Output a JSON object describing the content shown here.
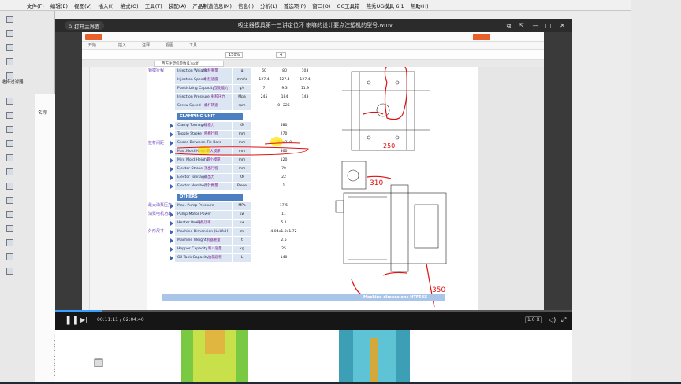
{
  "cad": {
    "menus": [
      "文件(F)",
      "编辑(E)",
      "视图(V)",
      "插入(I)",
      "格式(O)",
      "工具(T)",
      "装配(A)",
      "产品制造信息(M)",
      "信息(I)",
      "分析(L)",
      "首选项(P)",
      "窗口(O)",
      "GC工具箱",
      "燕秀UG模具 6.1",
      "帮助(H)"
    ],
    "tree_panel_title": "选择过滤器",
    "tree_name_header": "名称"
  },
  "player": {
    "open_home_label": "打开主界面",
    "title": "吸尘器模具第十三讲定位环 喇嘛的设计要点注塑机的型号.wmv",
    "time": "00:11:11 / 02:04:40",
    "speed": "1.0 X",
    "progress": 0.09
  },
  "pdf": {
    "tab_title": "西方注塑机参数(1).pdf",
    "zoom": "150%",
    "page_num": "4",
    "menu_items": [
      "开始",
      "插入",
      "注释",
      "视图",
      "工具"
    ],
    "rows": [
      {
        "label": "Injection Weight",
        "cn": "射胶重量",
        "unit": "g",
        "v1": "60",
        "v2": "80",
        "v3": "103"
      },
      {
        "label": "Injection Speed",
        "cn": "射胶速度",
        "unit": "mm/s",
        "v1": "127.4",
        "v2": "127.4",
        "v3": "127.4"
      },
      {
        "label": "Plasticizing Capacity",
        "cn": "塑化能力",
        "unit": "g/s",
        "v1": "7",
        "v2": "9.3",
        "v3": "11.9"
      },
      {
        "label": "Injection Pressure",
        "cn": "射胶压力",
        "unit": "Mpa",
        "v1": "245",
        "v2": "184",
        "v3": "143"
      },
      {
        "label": "Screw Speed",
        "cn": "螺杆转速",
        "unit": "rpm",
        "v1": "",
        "v2": "0~225",
        "v3": ""
      }
    ],
    "clamping_head": "CLAMPING UNIT",
    "clamping_rows": [
      {
        "label": "Clamp Tonnage",
        "cn": "锁模力",
        "unit": "KN",
        "v": "580"
      },
      {
        "label": "Toggle Stroke",
        "cn": "移模行程",
        "unit": "mm",
        "v": "270"
      },
      {
        "label": "Space Between Tie Bars",
        "cn": "拉杆内距",
        "unit": "mm",
        "v": "310x310"
      },
      {
        "label": "Max.Mold Height",
        "cn": "最大模厚",
        "unit": "mm",
        "v": "360"
      },
      {
        "label": "Min. Mold Height",
        "cn": "最小模厚",
        "unit": "mm",
        "v": "120"
      },
      {
        "label": "Ejector Stroke",
        "cn": "顶出行程",
        "unit": "mm",
        "v": "70"
      },
      {
        "label": "Ejector Tonnage",
        "cn": "顶出力",
        "unit": "KN",
        "v": "22"
      },
      {
        "label": "Ejector Number",
        "cn": "顶针数量",
        "unit": "Piece",
        "v": "1"
      }
    ],
    "others_head": "OTHERS",
    "others_rows": [
      {
        "label": "Max. Pump Pressure",
        "unit": "MPa",
        "v": "17.5"
      },
      {
        "label": "Pump Motor Power",
        "unit": "kw",
        "v": "11"
      },
      {
        "label": "Heater Power",
        "cn": "电热功率",
        "unit": "kw",
        "v": "5.1"
      },
      {
        "label": "Machine Dimension (LxWxH)",
        "unit": "m",
        "v": "4.04x1.0x1.72"
      },
      {
        "label": "Machine Weight",
        "cn": "机器重量",
        "unit": "t",
        "v": "2.5"
      },
      {
        "label": "Hopper Capacity",
        "cn": "料斗容量",
        "unit": "kg",
        "v": "25"
      },
      {
        "label": "Oil Tank Capacity",
        "cn": "油箱容积",
        "unit": "L",
        "v": "140"
      }
    ],
    "side_notes": [
      "锁模行程",
      "拉杆间距",
      "最大油泵压力",
      "油泵电机功率",
      "外形尺寸"
    ],
    "footer": "Machine dimensions HTF58X",
    "annotations": [
      "310",
      "350",
      "250"
    ]
  },
  "colors": {
    "accent": "#3aa0ff",
    "annotation_red": "#e01010",
    "highlight": "#ffe600"
  }
}
